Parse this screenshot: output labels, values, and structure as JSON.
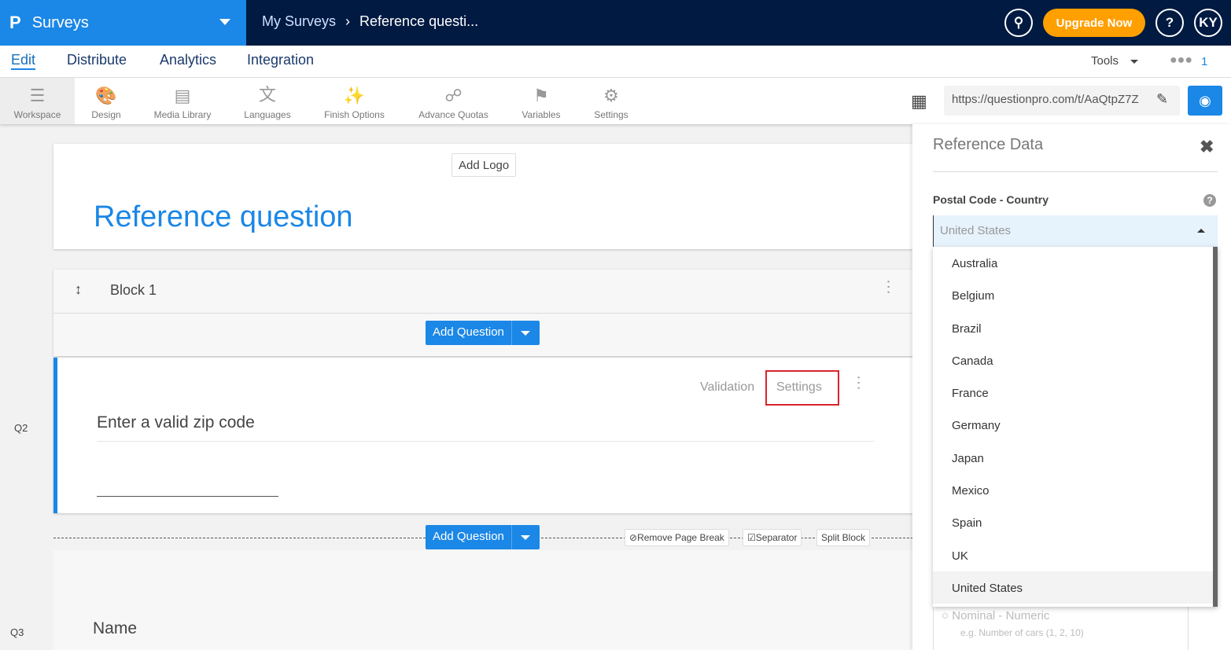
{
  "header": {
    "app_name": "Surveys",
    "breadcrumb": [
      "My Surveys",
      "Reference questi..."
    ],
    "upgrade_label": "Upgrade Now",
    "help_label": "?",
    "avatar_initials": "KY"
  },
  "tabs": [
    "Edit",
    "Distribute",
    "Analytics",
    "Integration"
  ],
  "tools_label": "Tools",
  "collaborators_count": "1",
  "toolbar": [
    "Workspace",
    "Design",
    "Media Library",
    "Languages",
    "Finish Options",
    "Advance Quotas",
    "Variables",
    "Settings"
  ],
  "survey_url": "https://questionpro.com/t/AaQtpZ7Z",
  "survey": {
    "add_logo": "Add Logo",
    "title": "Reference question",
    "block_name": "Block 1",
    "add_question": "Add Question",
    "q2": {
      "num": "Q2",
      "validation": "Validation",
      "settings": "Settings",
      "text": "Enter a valid zip code"
    },
    "page_actions": {
      "remove_page_break": "Remove Page Break",
      "separator": "Separator",
      "split_block": "Split Block"
    },
    "q3": {
      "num": "Q3",
      "text": "Name"
    }
  },
  "panel": {
    "title": "Reference Data",
    "field_label": "Postal Code - Country",
    "selected": "United States",
    "options": [
      "Australia",
      "Belgium",
      "Brazil",
      "Canada",
      "France",
      "Germany",
      "Japan",
      "Mexico",
      "Spain",
      "UK",
      "United States"
    ],
    "hidden_option": "Nominal - Numeric",
    "hidden_hint": "e.g. Number of cars (1, 2, 10)"
  },
  "colors": {
    "brand": "#1b87e6",
    "nav": "#001a42",
    "upgrade": "#ff9f00",
    "highlight": "#d9232d"
  }
}
